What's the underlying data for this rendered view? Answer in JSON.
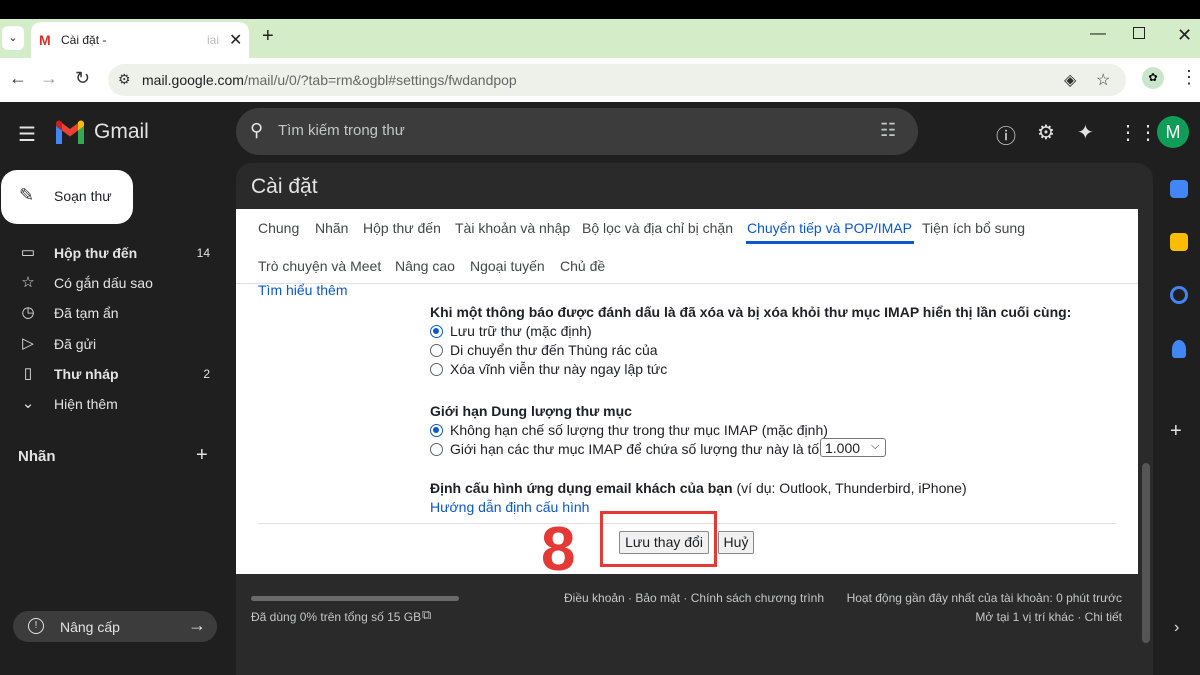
{
  "browser": {
    "tab_title": "Cài đặt -",
    "tab_title_faded": "iai",
    "url_host": "mail.google.com",
    "url_path": "/mail/u/0/?tab=rm&ogbl#settings/fwdandpop"
  },
  "gmail": {
    "logo_text": "Gmail",
    "search_placeholder": "Tìm kiếm trong thư",
    "avatar_letter": "M",
    "compose_label": "Soạn thư",
    "nav": [
      {
        "label": "Hộp thư đến",
        "count": "14",
        "icon": "inbox-icon"
      },
      {
        "label": "Có gắn dấu sao",
        "count": "",
        "icon": "star-icon"
      },
      {
        "label": "Đã tạm ẩn",
        "count": "",
        "icon": "clock-icon"
      },
      {
        "label": "Đã gửi",
        "count": "",
        "icon": "send-icon"
      },
      {
        "label": "Thư nháp",
        "count": "2",
        "icon": "draft-icon"
      },
      {
        "label": "Hiện thêm",
        "count": "",
        "icon": "chevron-down-icon"
      }
    ],
    "labels_title": "Nhãn",
    "upgrade_label": "Nâng cấp"
  },
  "settings": {
    "title": "Cài đặt",
    "tabs_row1": [
      "Chung",
      "Nhãn",
      "Hộp thư đến",
      "Tài khoản và nhập",
      "Bộ lọc và địa chỉ bị chặn",
      "Chuyển tiếp và POP/IMAP",
      "Tiện ích bổ sung"
    ],
    "tabs_row2": [
      "Trò chuyện và Meet",
      "Nâng cao",
      "Ngoại tuyến",
      "Chủ đề"
    ],
    "active_tab": "Chuyển tiếp và POP/IMAP",
    "learn_more": "Tìm hiểu thêm",
    "expunge_title": "Khi một thông báo được đánh dấu là đã xóa và bị xóa khỏi thư mục IMAP hiển thị lần cuối cùng:",
    "expunge_options": [
      "Lưu trữ thư (mặc định)",
      "Di chuyển thư đến Thùng rác của",
      "Xóa vĩnh viễn thư này ngay lập tức"
    ],
    "folder_title": "Giới hạn Dung lượng thư mục",
    "folder_options": [
      "Không hạn chế số lượng thư trong thư mục IMAP (mặc định)",
      "Giới hạn các thư mục IMAP để chứa số lượng thư này là tối đa"
    ],
    "folder_limit_value": "1.000",
    "client_title": "Định cấu hình ứng dụng email khách của bạn",
    "client_examples": " (ví dụ: Outlook, Thunderbird, iPhone)",
    "config_guide": "Hướng dẫn định cấu hình",
    "save_button": "Lưu thay đổi",
    "cancel_button": "Huỷ",
    "step_number": "8"
  },
  "footer": {
    "storage": "Đã dùng 0% trên tổng số 15 GB",
    "storage_used_fraction": 0,
    "links": "Điều khoản · Bảo mật · Chính sách chương trình",
    "activity": "Hoạt động gần đây nhất của tài khoản: 0 phút trước",
    "details": "Mở tại 1 vị trí khác · Chi tiết"
  },
  "colors": {
    "accent": "#0b57d0",
    "highlight": "#e53935",
    "background": "#1f1f1f"
  }
}
